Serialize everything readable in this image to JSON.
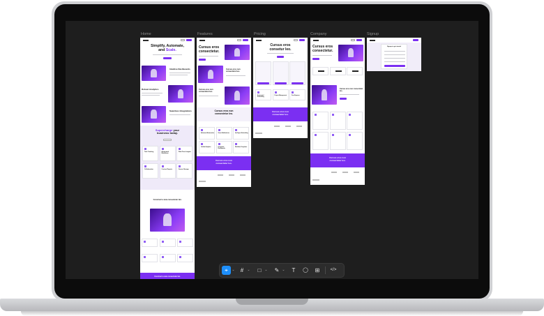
{
  "frames": [
    {
      "label": "Home"
    },
    {
      "label": "Features"
    },
    {
      "label": "Pricing"
    },
    {
      "label": "Company"
    },
    {
      "label": "Signup"
    }
  ],
  "home": {
    "hero_line1": "Simplify, Automate,",
    "hero_line2_plain": "and ",
    "hero_line2_accent": "Scale.",
    "feature1": "Intuitive Dashboards",
    "feature2": "Robust Analytics",
    "feature3": "Seamless Integrations",
    "supercharge_line1": "Supercharge",
    "supercharge_line1b": " your",
    "supercharge_line2": "business today.",
    "card_titles": [
      "Task Tracking",
      "Automated Workflows",
      "Real-Time Insights",
      "Collaboration",
      "Custom Reports",
      "Secure Storage"
    ],
    "mid_heading": "Construct a new consectetur lan.",
    "band_heading": "Construct a new consectetur lan."
  },
  "features": {
    "hero_line1": "Cursus eros",
    "hero_line2": "consectetur.",
    "section1": "Cursus eros non consectetur leo.",
    "section2": "Cursus eros non consectetur leo.",
    "mid_heading_line1": "Cursus eros non",
    "mid_heading_line2": "consectetur leo.",
    "card_titles": [
      "Advanced Automation",
      "Smart Notifications",
      "Intelligent Scheduling",
      "Unified Analytics",
      "Integrated Dashboards",
      "Workflow Templates"
    ],
    "band_line1": "Cursus eros non",
    "band_line2": "consectetur leo."
  },
  "pricing": {
    "hero_line1": "Cursus eros",
    "hero_line2": "consetur leo.",
    "card_titles": [
      "Automated Scheduling",
      "Project Management",
      "Free Expense"
    ],
    "band_line1": "Cursus eros non",
    "band_line2": "consectetur leo."
  },
  "company": {
    "hero_line1": "Cursus eros",
    "hero_line2": "consectetur.",
    "section1": "Cursus eros non consectetur leo.",
    "band_line1": "Cursus eros non",
    "band_line2": "consectetur leo."
  },
  "signup": {
    "heading": "Signup to get started",
    "button": "Sign up"
  },
  "toolbar": {
    "tools": [
      {
        "name": "move-tool",
        "glyph": "⌖"
      },
      {
        "name": "frame-tool",
        "glyph": "#"
      },
      {
        "name": "rectangle-tool",
        "glyph": "□"
      },
      {
        "name": "pen-tool",
        "glyph": "✎"
      },
      {
        "name": "text-tool",
        "glyph": "T"
      },
      {
        "name": "comment-tool",
        "glyph": "◯"
      },
      {
        "name": "components-tool",
        "glyph": "⊞"
      },
      {
        "name": "dev-mode-tool",
        "glyph": "</>"
      }
    ],
    "chevron": "⌄",
    "active_color": "#1e8ffa"
  },
  "colors": {
    "accent": "#7b2ff2",
    "canvas": "#1e1e1e"
  }
}
